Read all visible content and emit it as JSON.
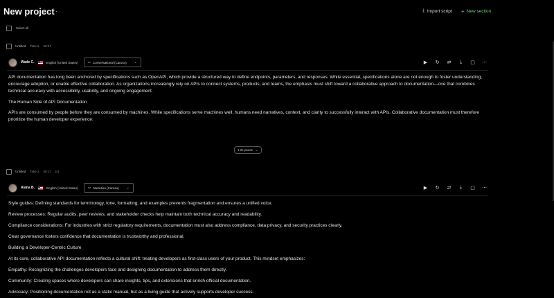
{
  "header": {
    "title": "New project",
    "menu": "···",
    "import_label": "Import script",
    "new_section_label": "New section"
  },
  "select_all": "Select all",
  "blocks": [
    {
      "title": "Untitled",
      "take": "Take 5",
      "time": "50:57",
      "speaker": "Wade C.",
      "language": "English (United States)",
      "voice": "Conversational (Caruso)",
      "paragraphs": [
        "API documentation has long been anchored by specifications such as OpenAPI, which provide a structured way to define endpoints, parameters, and responses. While essential, specifications alone are not enough to foster understanding, encourage adoption, or enable effective collaboration. As organizations increasingly rely on APIs to connect systems, products, and teams, the emphasis must shift toward a collaborative approach to documentation—one that combines technical accuracy with accessibility, usability, and ongoing engagement.",
        "The Human Side of API Documentation",
        "APIs are consumed by people before they are consumed by machines. While specifications serve machines well, humans need narratives, context, and clarity to successfully interact with APIs. Collaborative documentation must therefore prioritize the human developer experience:"
      ],
      "pause": "1.2s pause"
    },
    {
      "title": "Untitled",
      "take": "Take 2",
      "time": "50:17",
      "extra": "(x)",
      "speaker": "Alana B.",
      "language": "English (United States)",
      "voice": "Narration (Caruso)",
      "paragraphs": [
        "Style guides: Defining standards for terminology, tone, formatting, and examples prevents fragmentation and ensures a unified voice.",
        "Review processes: Regular audits, peer reviews, and stakeholder checks help maintain both technical accuracy and readability.",
        "Compliance considerations: For industries with strict regulatory requirements, documentation must also address compliance, data privacy, and security practices clearly.",
        "Clear governance fosters confidence that documentation is trustworthy and professional.",
        "Building a Developer-Centric Culture",
        "At its core, collaborative API documentation reflects a cultural shift: treating developers as first-class users of your product. This mindset emphasizes:",
        "Empathy: Recognizing the challenges developers face and designing documentation to address them directly.",
        "Community: Creating spaces where developers can share insights, tips, and extensions that enrich official documentation.",
        "Advocacy: Positioning documentation not as a static manual, but as a living guide that actively supports developer success."
      ]
    }
  ],
  "icons": [
    "play-icon",
    "regenerate-icon",
    "settings-icon",
    "download-icon",
    "comment-icon",
    "more-icon"
  ]
}
